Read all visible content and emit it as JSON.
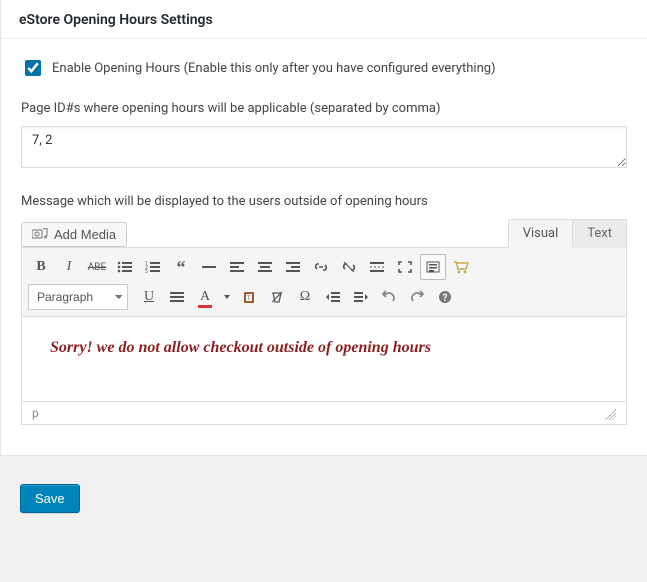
{
  "panel": {
    "title": "eStore Opening Hours Settings"
  },
  "enable": {
    "checked": true,
    "label": "Enable Opening Hours (Enable this only after you have configured everything)"
  },
  "page_ids": {
    "label": "Page ID#s where opening hours will be applicable (separated by comma)",
    "value": "7, 2"
  },
  "message_field": {
    "label": "Message which will be displayed to the users outside of opening hours"
  },
  "add_media_btn": "Add Media",
  "editor": {
    "tabs": {
      "visual": "Visual",
      "text": "Text",
      "active": "visual"
    },
    "format_select": "Paragraph",
    "content": "Sorry! we do not allow checkout outside of opening hours",
    "status_path": "p"
  },
  "save_btn": "Save"
}
